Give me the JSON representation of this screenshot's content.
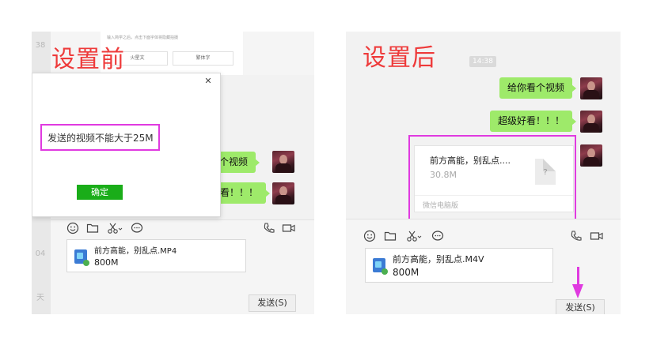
{
  "colors": {
    "accent_green": "#1aad19",
    "bubble_green": "#9eea6a",
    "highlight": "#e03ae0",
    "title_red": "#ee3a3a"
  },
  "left": {
    "title": "设置前",
    "sidebar_ticks": [
      "38",
      "04",
      "天"
    ],
    "bg_window": {
      "hint": "输入简学之后，点击下面字体将隐藏拍摄",
      "buttons": [
        "火星文",
        "繁体字"
      ]
    },
    "dialog": {
      "message": "发送的视频不能大于25M",
      "ok_label": "确定",
      "close_icon": "close-icon"
    },
    "messages": [
      {
        "text": "你看个视频"
      },
      {
        "text": "好看！！！"
      }
    ],
    "toolbar_icons": [
      "emoji-icon",
      "folder-icon",
      "scissors-icon",
      "chat-bubble-icon",
      "phone-icon",
      "video-icon"
    ],
    "attachment": {
      "name": "前方高能，别乱点.MP4",
      "size": "800M"
    },
    "send_label": "发送(S)"
  },
  "right": {
    "title": "设置后",
    "time": "14:38",
    "messages": [
      {
        "text": "给你看个视频"
      },
      {
        "text": "超级好看！！！"
      }
    ],
    "file_card": {
      "title": "前方高能，别乱点....",
      "size": "30.8M",
      "source": "微信电脑版",
      "icon_glyph": "?"
    },
    "toolbar_icons": [
      "emoji-icon",
      "folder-icon",
      "scissors-icon",
      "chat-bubble-icon",
      "phone-icon",
      "video-icon"
    ],
    "attachment": {
      "name": "前方高能，别乱点.M4V",
      "size": "800M"
    },
    "send_label": "发送(S)"
  }
}
